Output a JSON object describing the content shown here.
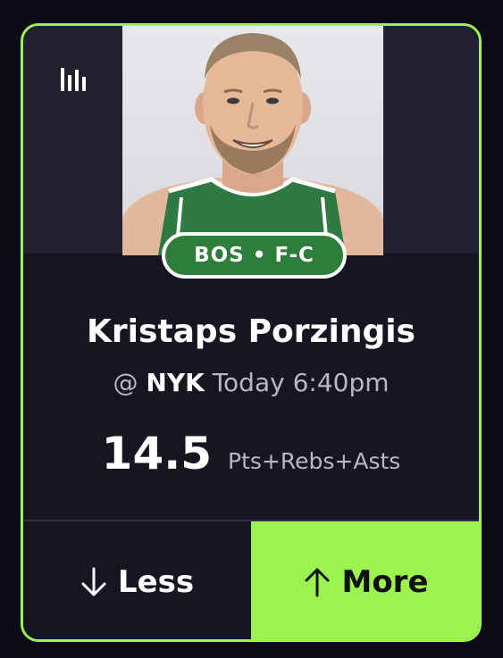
{
  "card": {
    "team_position": "BOS • F-C",
    "player_name": "Kristaps Porzingis",
    "matchup_prefix": "@",
    "opponent": "NYK",
    "game_time": "Today 6:40pm",
    "line_value": "14.5",
    "stat_label": "Pts+Rebs+Asts",
    "less_label": "Less",
    "more_label": "More"
  },
  "icons": {
    "stats": "bar-chart-icon",
    "less": "arrow-down-icon",
    "more": "arrow-up-icon"
  },
  "colors": {
    "accent": "#9cf34f",
    "badge": "#2e7d3a",
    "card_bg": "#161622",
    "page_bg": "#0c0c16"
  }
}
